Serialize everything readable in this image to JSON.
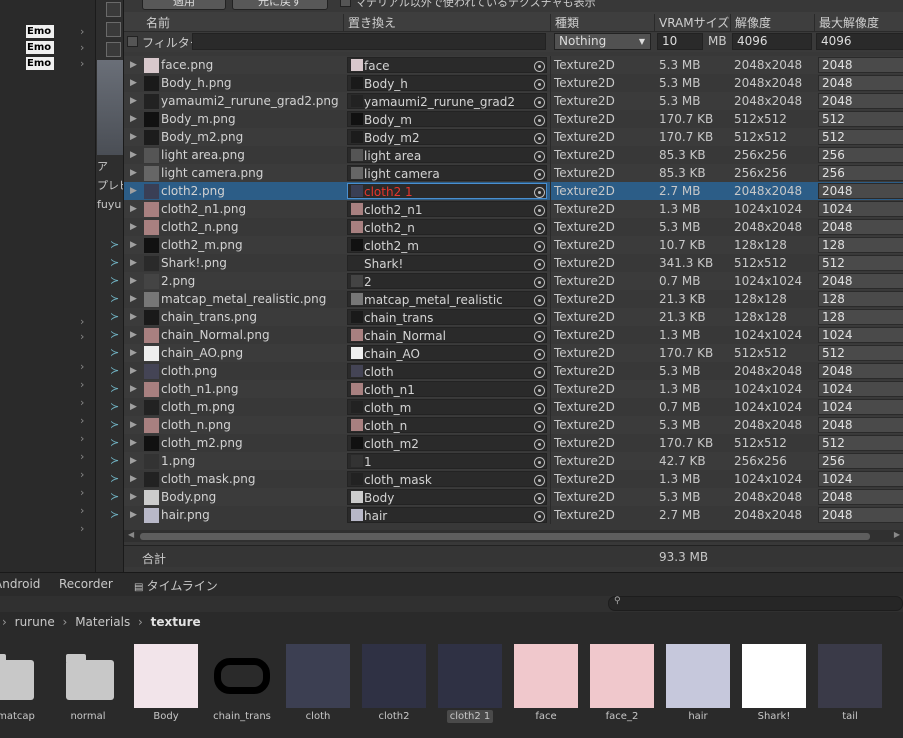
{
  "left_panel": {
    "emo_labels": [
      "Emo",
      "Emo",
      "Emo"
    ],
    "mid_labels": [
      "ア",
      "プレビ",
      "fuyu"
    ]
  },
  "top_buttons": {
    "apply": "適用",
    "revert": "元に戻す",
    "show_unused": "マテリアル以外で使われているテクスチャも表示"
  },
  "columns": {
    "name": "名前",
    "replace": "置き換え",
    "type": "種類",
    "vram": "VRAMサイズ",
    "resolution": "解像度",
    "max_resolution": "最大解像度"
  },
  "filter": {
    "label": "フィルター",
    "name_value": "",
    "type_value": "Nothing",
    "vram_value": "10",
    "vram_unit": "MB",
    "res_value": "4096",
    "max_value": "4096"
  },
  "rows": [
    {
      "name": "face.png",
      "replace": "face",
      "type": "Texture2D",
      "vram": "5.3 MB",
      "res": "2048x2048",
      "max": "2048",
      "thumb": "#d8c8cc"
    },
    {
      "name": "Body_h.png",
      "replace": "Body_h",
      "type": "Texture2D",
      "vram": "5.3 MB",
      "res": "2048x2048",
      "max": "2048",
      "thumb": "#1a1a1a"
    },
    {
      "name": "yamaumi2_rurune_grad2.png",
      "replace": "yamaumi2_rurune_grad2",
      "type": "Texture2D",
      "vram": "5.3 MB",
      "res": "2048x2048",
      "max": "2048",
      "thumb": "#222222"
    },
    {
      "name": "Body_m.png",
      "replace": "Body_m",
      "type": "Texture2D",
      "vram": "170.7 KB",
      "res": "512x512",
      "max": "512",
      "thumb": "#111111"
    },
    {
      "name": "Body_m2.png",
      "replace": "Body_m2",
      "type": "Texture2D",
      "vram": "170.7 KB",
      "res": "512x512",
      "max": "512",
      "thumb": "#1c1c1c"
    },
    {
      "name": "light area.png",
      "replace": "light area",
      "type": "Texture2D",
      "vram": "85.3 KB",
      "res": "256x256",
      "max": "256",
      "thumb": "#555555"
    },
    {
      "name": "light camera.png",
      "replace": "light camera",
      "type": "Texture2D",
      "vram": "85.3 KB",
      "res": "256x256",
      "max": "256",
      "thumb": "#666666"
    },
    {
      "name": "cloth2.png",
      "replace": "cloth2 1",
      "type": "Texture2D",
      "vram": "2.7 MB",
      "res": "2048x2048",
      "max": "2048",
      "thumb": "#3a3f55",
      "selected": true
    },
    {
      "name": "cloth2_n1.png",
      "replace": "cloth2_n1",
      "type": "Texture2D",
      "vram": "1.3 MB",
      "res": "1024x1024",
      "max": "1024",
      "thumb": "#a88080"
    },
    {
      "name": "cloth2_n.png",
      "replace": "cloth2_n",
      "type": "Texture2D",
      "vram": "5.3 MB",
      "res": "2048x2048",
      "max": "2048",
      "thumb": "#a88080"
    },
    {
      "name": "cloth2_m.png",
      "replace": "cloth2_m",
      "type": "Texture2D",
      "vram": "10.7 KB",
      "res": "128x128",
      "max": "128",
      "thumb": "#111111"
    },
    {
      "name": "Shark!.png",
      "replace": "Shark!",
      "type": "Texture2D",
      "vram": "341.3 KB",
      "res": "512x512",
      "max": "512",
      "thumb": "#2a2a2a"
    },
    {
      "name": "2.png",
      "replace": "2",
      "type": "Texture2D",
      "vram": "0.7 MB",
      "res": "1024x1024",
      "max": "2048",
      "thumb": "#444444"
    },
    {
      "name": "matcap_metal_realistic.png",
      "replace": "matcap_metal_realistic",
      "type": "Texture2D",
      "vram": "21.3 KB",
      "res": "128x128",
      "max": "128",
      "thumb": "#777777"
    },
    {
      "name": "chain_trans.png",
      "replace": "chain_trans",
      "type": "Texture2D",
      "vram": "21.3 KB",
      "res": "128x128",
      "max": "128",
      "thumb": "#1a1a1a"
    },
    {
      "name": "chain_Normal.png",
      "replace": "chain_Normal",
      "type": "Texture2D",
      "vram": "1.3 MB",
      "res": "1024x1024",
      "max": "1024",
      "thumb": "#a88080"
    },
    {
      "name": "chain_AO.png",
      "replace": "chain_AO",
      "type": "Texture2D",
      "vram": "170.7 KB",
      "res": "512x512",
      "max": "512",
      "thumb": "#eeeeee"
    },
    {
      "name": "cloth.png",
      "replace": "cloth",
      "type": "Texture2D",
      "vram": "5.3 MB",
      "res": "2048x2048",
      "max": "2048",
      "thumb": "#444455"
    },
    {
      "name": "cloth_n1.png",
      "replace": "cloth_n1",
      "type": "Texture2D",
      "vram": "1.3 MB",
      "res": "1024x1024",
      "max": "1024",
      "thumb": "#a88080"
    },
    {
      "name": "cloth_m.png",
      "replace": "cloth_m",
      "type": "Texture2D",
      "vram": "0.7 MB",
      "res": "1024x1024",
      "max": "1024",
      "thumb": "#222222"
    },
    {
      "name": "cloth_n.png",
      "replace": "cloth_n",
      "type": "Texture2D",
      "vram": "5.3 MB",
      "res": "2048x2048",
      "max": "2048",
      "thumb": "#a88080"
    },
    {
      "name": "cloth_m2.png",
      "replace": "cloth_m2",
      "type": "Texture2D",
      "vram": "170.7 KB",
      "res": "512x512",
      "max": "512",
      "thumb": "#111111"
    },
    {
      "name": "1.png",
      "replace": "1",
      "type": "Texture2D",
      "vram": "42.7 KB",
      "res": "256x256",
      "max": "256",
      "thumb": "#333333"
    },
    {
      "name": "cloth_mask.png",
      "replace": "cloth_mask",
      "type": "Texture2D",
      "vram": "1.3 MB",
      "res": "1024x1024",
      "max": "1024",
      "thumb": "#222222"
    },
    {
      "name": "Body.png",
      "replace": "Body",
      "type": "Texture2D",
      "vram": "5.3 MB",
      "res": "2048x2048",
      "max": "2048",
      "thumb": "#cccccc"
    },
    {
      "name": "hair.png",
      "replace": "hair",
      "type": "Texture2D",
      "vram": "2.7 MB",
      "res": "2048x2048",
      "max": "2048",
      "thumb": "#b8b8c8"
    }
  ],
  "total": {
    "label": "合計",
    "value": "93.3 MB"
  },
  "bottom_tabs": [
    "Android",
    "Recorder",
    "タイムライン"
  ],
  "breadcrumb": [
    "rurune",
    "Materials",
    "texture"
  ],
  "assets": [
    {
      "label": "matcap",
      "kind": "folder"
    },
    {
      "label": "normal",
      "kind": "folder"
    },
    {
      "label": "Body",
      "kind": "tex",
      "color": "#f2e4ea"
    },
    {
      "label": "chain_trans",
      "kind": "ring"
    },
    {
      "label": "cloth",
      "kind": "tex",
      "color": "#3c3f52"
    },
    {
      "label": "cloth2",
      "kind": "tex",
      "color": "#2f3144"
    },
    {
      "label": "cloth2 1",
      "kind": "tex",
      "color": "#2f3144",
      "selected": true
    },
    {
      "label": "face",
      "kind": "tex",
      "color": "#f0c8cc"
    },
    {
      "label": "face_2",
      "kind": "tex",
      "color": "#f0c8cc"
    },
    {
      "label": "hair",
      "kind": "tex",
      "color": "#c6c8dc"
    },
    {
      "label": "Shark!",
      "kind": "tex",
      "color": "#ffffff"
    },
    {
      "label": "tail",
      "kind": "tex",
      "color": "#3a3a48"
    }
  ],
  "colors": {
    "selection": "#2c5d87",
    "missing_replace": "#e8352c"
  }
}
